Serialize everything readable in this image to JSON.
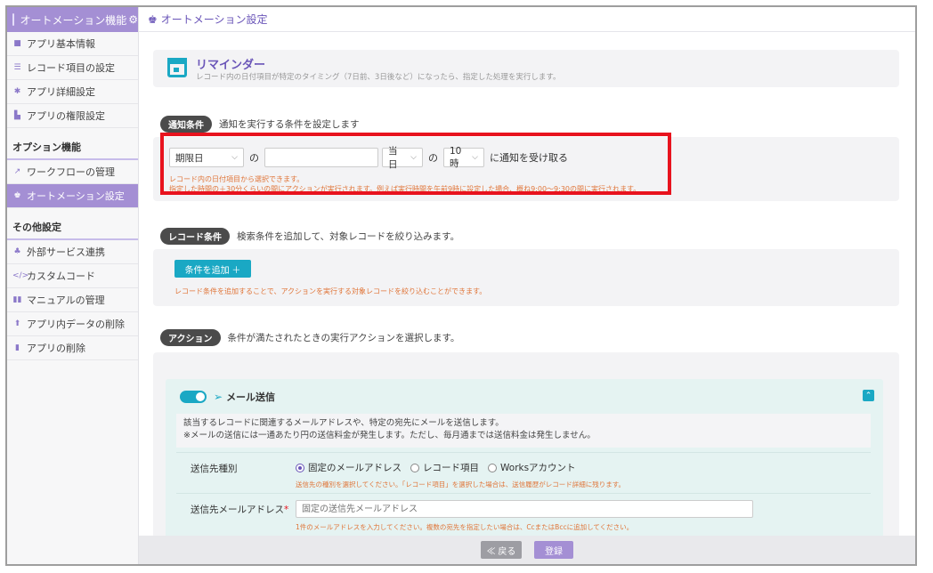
{
  "sidebar": {
    "header": "オートメーション機能",
    "items": [
      {
        "label": "アプリ基本情報",
        "icon": "info-icon"
      },
      {
        "label": "レコード項目の設定",
        "icon": "list-icon"
      },
      {
        "label": "アプリ詳細設定",
        "icon": "gear-icon"
      },
      {
        "label": "アプリの権限設定",
        "icon": "users-icon"
      }
    ],
    "group_options": "オプション機能",
    "options": [
      {
        "label": "ワークフローの管理",
        "icon": "workflow-icon"
      },
      {
        "label": "オートメーション設定",
        "icon": "automation-icon",
        "active": true
      }
    ],
    "group_other": "その他設定",
    "others": [
      {
        "label": "外部サービス連携",
        "icon": "link-icon"
      },
      {
        "label": "カスタムコード",
        "icon": "code-icon"
      },
      {
        "label": "マニュアルの管理",
        "icon": "book-icon"
      },
      {
        "label": "アプリ内データの削除",
        "icon": "delete-data-icon"
      },
      {
        "label": "アプリの削除",
        "icon": "trash-icon"
      }
    ]
  },
  "topbar": {
    "title": "オートメーション設定"
  },
  "reminder": {
    "title": "リマインダー",
    "description": "レコード内の日付項目が特定のタイミング（7日前、3日後など）になったら、指定した処理を実行します。"
  },
  "notify": {
    "pill": "通知条件",
    "text": "通知を実行する条件を設定します",
    "field_value": "期限日",
    "no1": "の",
    "timing_value": "当日",
    "no2": "の",
    "time_value": "10時",
    "suffix": "に通知を受け取る",
    "note1": "レコード内の日付項目から選択できます。",
    "note2": "指定した時間の＋30分くらいの間にアクションが実行されます。例えば実行時間を午前9時に設定した場合、概ね9:00〜9:30の間に実行されます。"
  },
  "record": {
    "pill": "レコード条件",
    "text": "検索条件を追加して、対象レコードを絞り込みます。",
    "add_button": "条件を追加 ＋",
    "note": "レコード条件を追加することで、アクションを実行する対象レコードを絞り込むことができます。"
  },
  "action": {
    "pill": "アクション",
    "text": "条件が満たされたときの実行アクションを選択します。",
    "mail_title": "メール送信",
    "desc1": "該当するレコードに関連するメールアドレスや、特定の宛先にメールを送信します。",
    "desc2": "※メールの送信には一通あたり円の送信料金が発生します。ただし、毎月通までは送信料金は発生しません。",
    "dest_type_label": "送信先種別",
    "radio1": "固定のメールアドレス",
    "radio2": "レコード項目",
    "radio3": "Worksアカウント",
    "dest_type_hint": "送信先の種別を選択してください。「レコード項目」を選択した場合は、送信履歴がレコード詳細に残ります。",
    "email_label": "送信先メールアドレス",
    "required_mark": "*",
    "email_placeholder": "固定の送信先メールアドレス",
    "email_hint": "1件のメールアドレスを入力してください。複数の宛先を指定したい場合は、CcまたはBccに追加してください。"
  },
  "footer": {
    "back": "≪ 戻る",
    "submit": "登録"
  },
  "colors": {
    "accent": "#a48fd4",
    "teal": "#1aa8c4",
    "highlight": "#e8131e"
  }
}
